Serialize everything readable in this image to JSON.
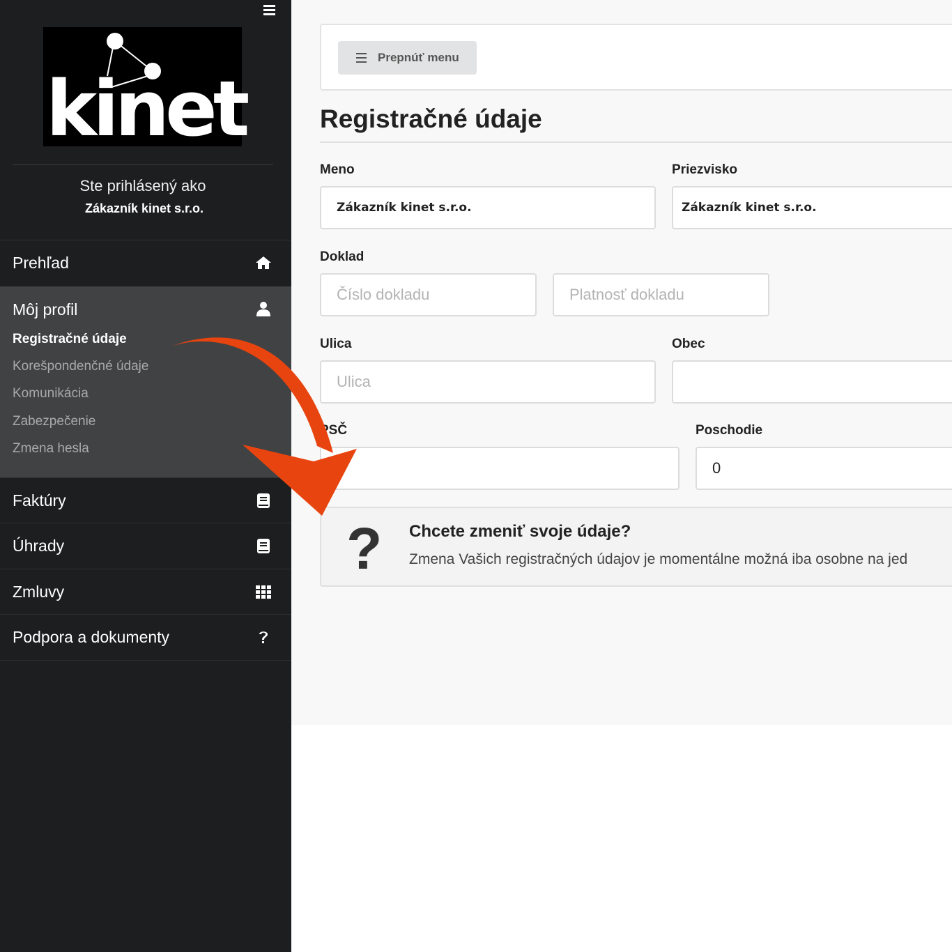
{
  "sidebar": {
    "logo_text": "kinet",
    "logged_in_label": "Ste prihlásený ako",
    "logged_in_name": "Zákazník kinet s.r.o.",
    "nav": [
      {
        "label": "Prehľad",
        "icon": "home-icon"
      },
      {
        "label": "Môj profil",
        "icon": "user-icon"
      },
      {
        "label": "Faktúry",
        "icon": "book-icon"
      },
      {
        "label": "Úhrady",
        "icon": "book-icon"
      },
      {
        "label": "Zmluvy",
        "icon": "grid-icon"
      },
      {
        "label": "Podpora a dokumenty",
        "icon": "question-icon"
      }
    ],
    "profile_sub": [
      {
        "label": "Registračné údaje",
        "active": true
      },
      {
        "label": "Korešpondenčné údaje"
      },
      {
        "label": "Komunikácia"
      },
      {
        "label": "Zabezpečenie"
      },
      {
        "label": "Zmena hesla"
      }
    ]
  },
  "toolbar": {
    "toggle_label": "Prepnúť menu"
  },
  "main": {
    "title": "Registračné údaje",
    "form": {
      "meno_label": "Meno",
      "meno_value": "Zákazník kinet s.r.o.",
      "priezvisko_label": "Priezvisko",
      "priezvisko_value": "Zákazník kinet s.r.o.",
      "doklad_label": "Doklad",
      "cislo_placeholder": "Číslo dokladu",
      "platnost_placeholder": "Platnosť dokladu",
      "ulica_label": "Ulica",
      "ulica_placeholder": "Ulica",
      "obec_label": "Obec",
      "obec_value": "",
      "psc_label": "PSČ",
      "psc_value": "",
      "poschodie_label": "Poschodie",
      "poschodie_value": "0"
    },
    "info": {
      "title": "Chcete zmeniť svoje údaje?",
      "text": "Zmena Vašich registračných údajov je momentálne možná iba osobne na jed"
    }
  },
  "colors": {
    "sidebar_bg": "#1d1e20",
    "sidebar_active_bg": "#404244",
    "arrow": "#e8440f"
  }
}
